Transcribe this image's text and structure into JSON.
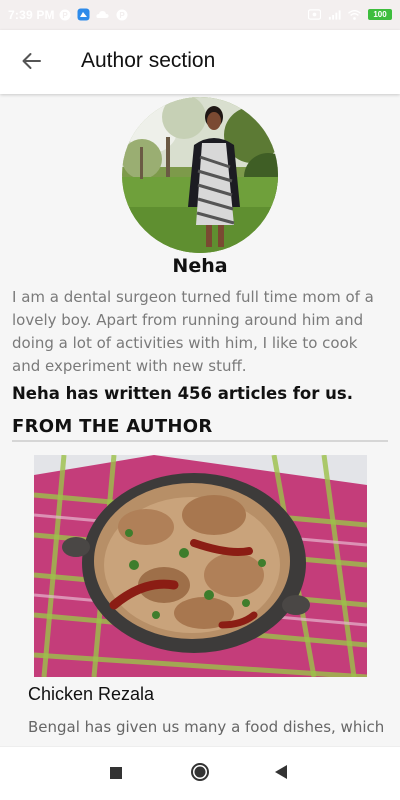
{
  "status_bar": {
    "time": "7:39 PM",
    "battery": "100",
    "icons": [
      "p-notification-icon",
      "app-notification-icon",
      "cloud-icon",
      "p-notification-icon",
      "screen-record-icon",
      "signal-icon",
      "wifi-icon",
      "battery-icon"
    ]
  },
  "app_bar": {
    "title": "Author section",
    "back_icon": "arrow-back-icon"
  },
  "author": {
    "name": "Neha",
    "bio": "I am a dental surgeon turned full time mom of a lovely boy. Apart from running around him and doing a lot of activities with him, I like to cook and experiment with new stuff.",
    "articles_count_text": "Neha has written 456 articles for us."
  },
  "section": {
    "heading": "FROM THE AUTHOR"
  },
  "articles": [
    {
      "title": "Chicken Rezala",
      "excerpt": "Bengal has given us many a food dishes, which"
    }
  ],
  "nav_bar": {
    "icons": [
      "recents-square-icon",
      "home-circle-icon",
      "back-triangle-icon"
    ]
  },
  "colors": {
    "status_bar_bg": "#f3efef",
    "app_bar_bg": "#ffffff",
    "page_bg": "#f6f6f6",
    "bio_text": "#7a7a7a",
    "battery_green": "#3dbd3d"
  }
}
